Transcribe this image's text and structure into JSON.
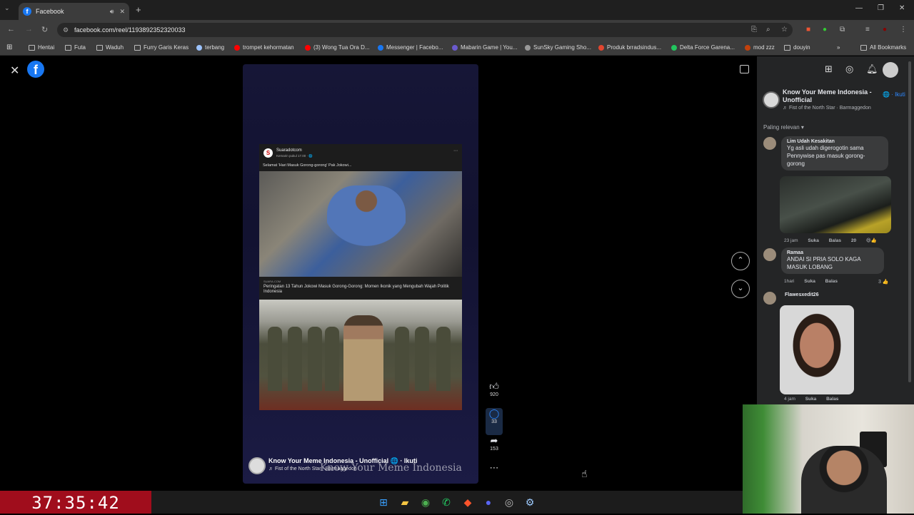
{
  "browser": {
    "tab_title": "Facebook",
    "url": "facebook.com/reel/1193892352320033",
    "bookmarks": [
      {
        "label": "Hentai",
        "icon": "folder-icon",
        "color": "#bbbbbb"
      },
      {
        "label": "Futa",
        "icon": "folder-icon",
        "color": "#bbbbbb"
      },
      {
        "label": "Waduh",
        "icon": "folder-icon",
        "color": "#bbbbbb"
      },
      {
        "label": "Furry Garis Keras",
        "icon": "folder-icon",
        "color": "#bbbbbb"
      },
      {
        "label": "terbang",
        "icon": "site-icon",
        "color": "#9cc3ff"
      },
      {
        "label": "trompet kehormatan",
        "icon": "youtube-icon",
        "color": "#ff0000"
      },
      {
        "label": "(3) Wong Tua Ora D...",
        "icon": "youtube-icon",
        "color": "#ff0000"
      },
      {
        "label": "Messenger | Facebo...",
        "icon": "facebook-icon",
        "color": "#1877f2"
      },
      {
        "label": "Mabarin Game | You...",
        "icon": "site-icon",
        "color": "#6a5acd"
      },
      {
        "label": "SunSky Gaming Sho...",
        "icon": "site-icon",
        "color": "#999999"
      },
      {
        "label": "Produk brradsindus...",
        "icon": "site-icon",
        "color": "#e2462f"
      },
      {
        "label": "Delta Force Garena...",
        "icon": "site-icon",
        "color": "#22c55e"
      },
      {
        "label": "mod zzz",
        "icon": "site-icon",
        "color": "#c2410c"
      },
      {
        "label": "douyin",
        "icon": "folder-icon",
        "color": "#bbbbbb"
      }
    ],
    "all_bookmarks": "All Bookmarks"
  },
  "reel": {
    "post": {
      "source": "Suaradotcom",
      "time": "Kemarin pukul 17.00 · 🌐",
      "caption": "Selamat 'Hari Masuk Gorong-gorong' Pak Jokowi...",
      "link_domain": "SUARA.COM",
      "link_title": "Peringatan 13 Tahun Jokowi Masuk Gorong-Gorong: Momen Ikonik yang Mengubah Wajah Politik Indonesia"
    },
    "page_name": "Know Your Meme Indonesia - Unofficial",
    "follow": "Ikuti",
    "song": "Fist of the North Star · Barmaggedon",
    "watermark": "Know Your Meme Indonesia",
    "likes": "920",
    "comments": "33",
    "shares": "153"
  },
  "panel": {
    "page_name": "Know Your Meme Indonesia - Unofficial",
    "follow": "Ikuti",
    "song": "Fist of the North Star · Barmaggedon",
    "sort_label": "Paling relevan",
    "comments": [
      {
        "author": "Lim Udah Kesakitan",
        "text": "Yg asli udah digerogotin sama Pennywise pas masuk gorong-gorong",
        "time": "23 jam",
        "like": "Suka",
        "reply": "Balas",
        "reactions": "20"
      },
      {
        "author": "Ramaa",
        "text": "ANDAI SI PRIA SOLO KAGA MASUK LOBANG",
        "time": "1hari",
        "like": "Suka",
        "reply": "Balas",
        "reactions": "3"
      },
      {
        "author": "Flawesxedit26",
        "text": "",
        "time": "4 jam",
        "like": "Suka",
        "reply": "Balas",
        "reactions": ""
      }
    ]
  },
  "timer": "37:35:42",
  "colors": {
    "accent": "#1877f2",
    "timer_bg": "#a00d1c"
  }
}
